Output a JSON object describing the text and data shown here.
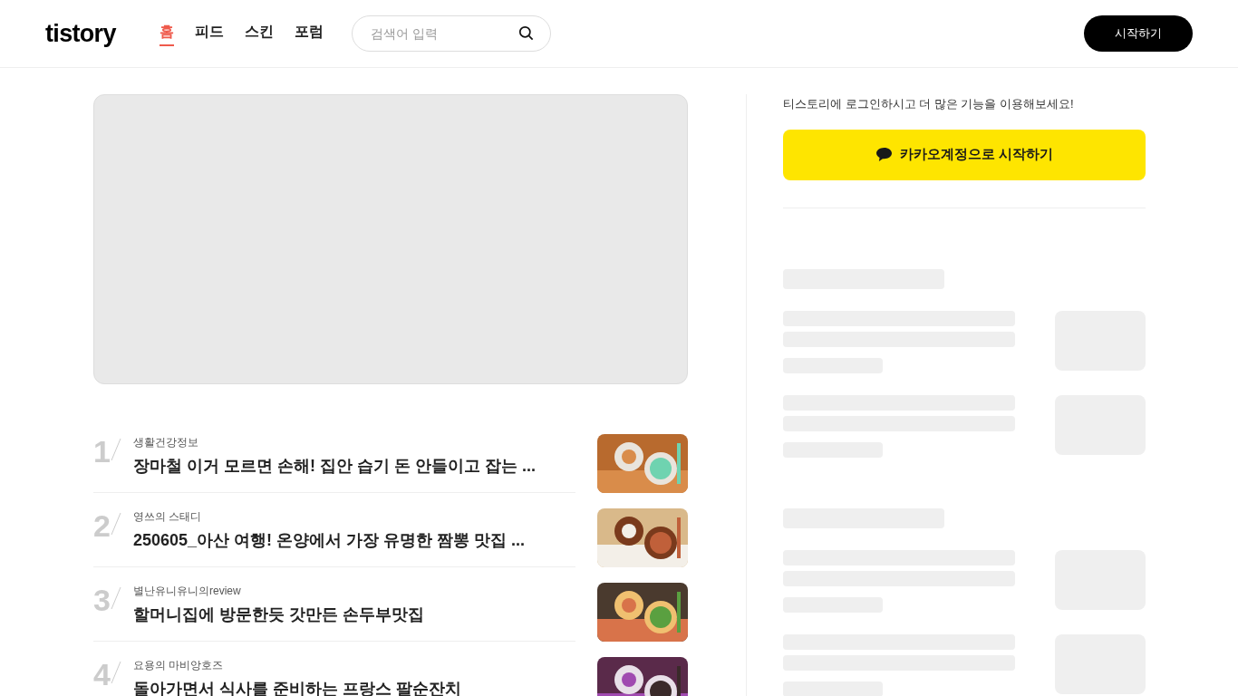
{
  "header": {
    "logo": "tistory",
    "nav": [
      {
        "label": "홈",
        "selected": true
      },
      {
        "label": "피드",
        "selected": false
      },
      {
        "label": "스킨",
        "selected": false
      },
      {
        "label": "포럼",
        "selected": false
      }
    ],
    "search": {
      "placeholder": "검색어 입력"
    },
    "start_button": "시작하기"
  },
  "popular": [
    {
      "rank": "1",
      "category": "생활건강정보",
      "title": "장마철 이거 모르면 손해! 집안 습기 돈 안들이고 잡는 ..."
    },
    {
      "rank": "2",
      "category": "영쓰의 스태디",
      "title": "250605_아산 여행! 온양에서 가장 유명한 짬뽕 맛집 ..."
    },
    {
      "rank": "3",
      "category": "별난유니유니의review",
      "title": "할머니집에 방문한듯 갓만든 손두부맛집"
    },
    {
      "rank": "4",
      "category": "요용의 마비앙호즈",
      "title": "돌아가면서 식사를 준비하는 프랑스 팔순잔치"
    }
  ],
  "sidebar": {
    "login_prompt": "티스토리에 로그인하시고 더 많은 기능을 이용해보세요!",
    "kakao_button": "카카오계정으로 시작하기"
  }
}
